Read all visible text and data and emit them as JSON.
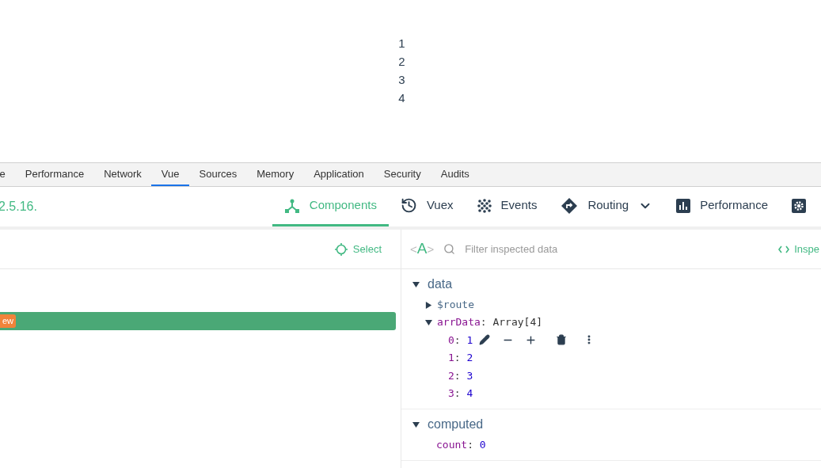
{
  "page": {
    "list": [
      "1",
      "2",
      "3",
      "4"
    ]
  },
  "devtools_tabs": [
    {
      "label": "e",
      "selected": false
    },
    {
      "label": "Performance",
      "selected": false
    },
    {
      "label": "Network",
      "selected": false
    },
    {
      "label": "Vue",
      "selected": true
    },
    {
      "label": "Sources",
      "selected": false
    },
    {
      "label": "Memory",
      "selected": false
    },
    {
      "label": "Application",
      "selected": false
    },
    {
      "label": "Security",
      "selected": false
    },
    {
      "label": "Audits",
      "selected": false
    }
  ],
  "vue_header": {
    "version": "2.5.16.",
    "tabs": [
      {
        "kind": "components",
        "label": "Components",
        "selected": true,
        "dropdown": false
      },
      {
        "kind": "vuex",
        "label": "Vuex",
        "selected": false,
        "dropdown": false
      },
      {
        "kind": "events",
        "label": "Events",
        "selected": false,
        "dropdown": false
      },
      {
        "kind": "routing",
        "label": "Routing",
        "selected": false,
        "dropdown": true
      },
      {
        "kind": "performance",
        "label": "Performance",
        "selected": false,
        "dropdown": false
      },
      {
        "kind": "settings",
        "selected": false,
        "dropdown": false
      }
    ]
  },
  "component_tree": {
    "select_label": "Select",
    "rows": [
      {
        "badge": "ew",
        "selected": true
      }
    ]
  },
  "inspector": {
    "format_toggle": [
      "<",
      "A",
      ">"
    ],
    "separator": ":",
    "filter_placeholder": "Filter inspected data",
    "inspect_label": "Inspe",
    "sections": [
      {
        "title": "data",
        "expanded": true,
        "props": [
          {
            "key": "$route",
            "kind": "object",
            "expanded": false
          },
          {
            "key": "arrData",
            "value": "Array[4]",
            "kind": "array",
            "expanded": true,
            "children": [
              {
                "key": "0",
                "value": "1",
                "hovered": true
              },
              {
                "key": "1",
                "value": "2",
                "hovered": false
              },
              {
                "key": "2",
                "value": "3",
                "hovered": false
              },
              {
                "key": "3",
                "value": "4",
                "hovered": false
              }
            ]
          }
        ]
      },
      {
        "title": "computed",
        "expanded": true,
        "props": [
          {
            "key": "count",
            "value": "0",
            "kind": "value"
          }
        ]
      }
    ]
  }
}
